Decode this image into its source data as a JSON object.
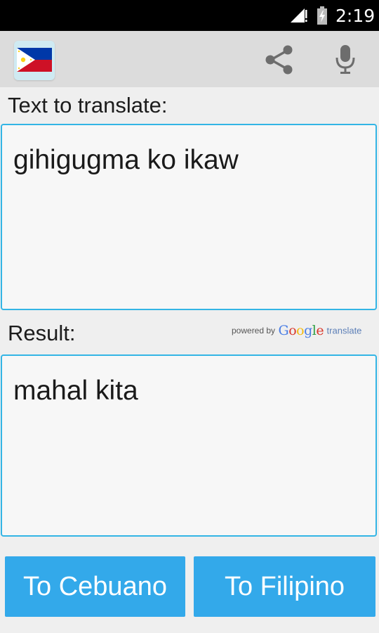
{
  "status_bar": {
    "time": "2:19"
  },
  "action_bar": {
    "app_icon": "philippine-flag-icon",
    "actions": [
      "share-icon",
      "microphone-icon"
    ]
  },
  "input": {
    "label": "Text to translate:",
    "value": "gihigugma ko ikaw"
  },
  "result": {
    "label": "Result:",
    "value": "mahal kita",
    "attribution": {
      "prefix": "powered by",
      "brand": "Google",
      "suffix": "translate"
    }
  },
  "buttons": {
    "to_cebuano": "To Cebuano",
    "to_filipino": "To Filipino"
  },
  "colors": {
    "accent": "#33b5e5",
    "button": "#33a9ea",
    "flag_blue": "#0038a8",
    "flag_red": "#ce1126",
    "flag_yellow": "#fcd116"
  }
}
